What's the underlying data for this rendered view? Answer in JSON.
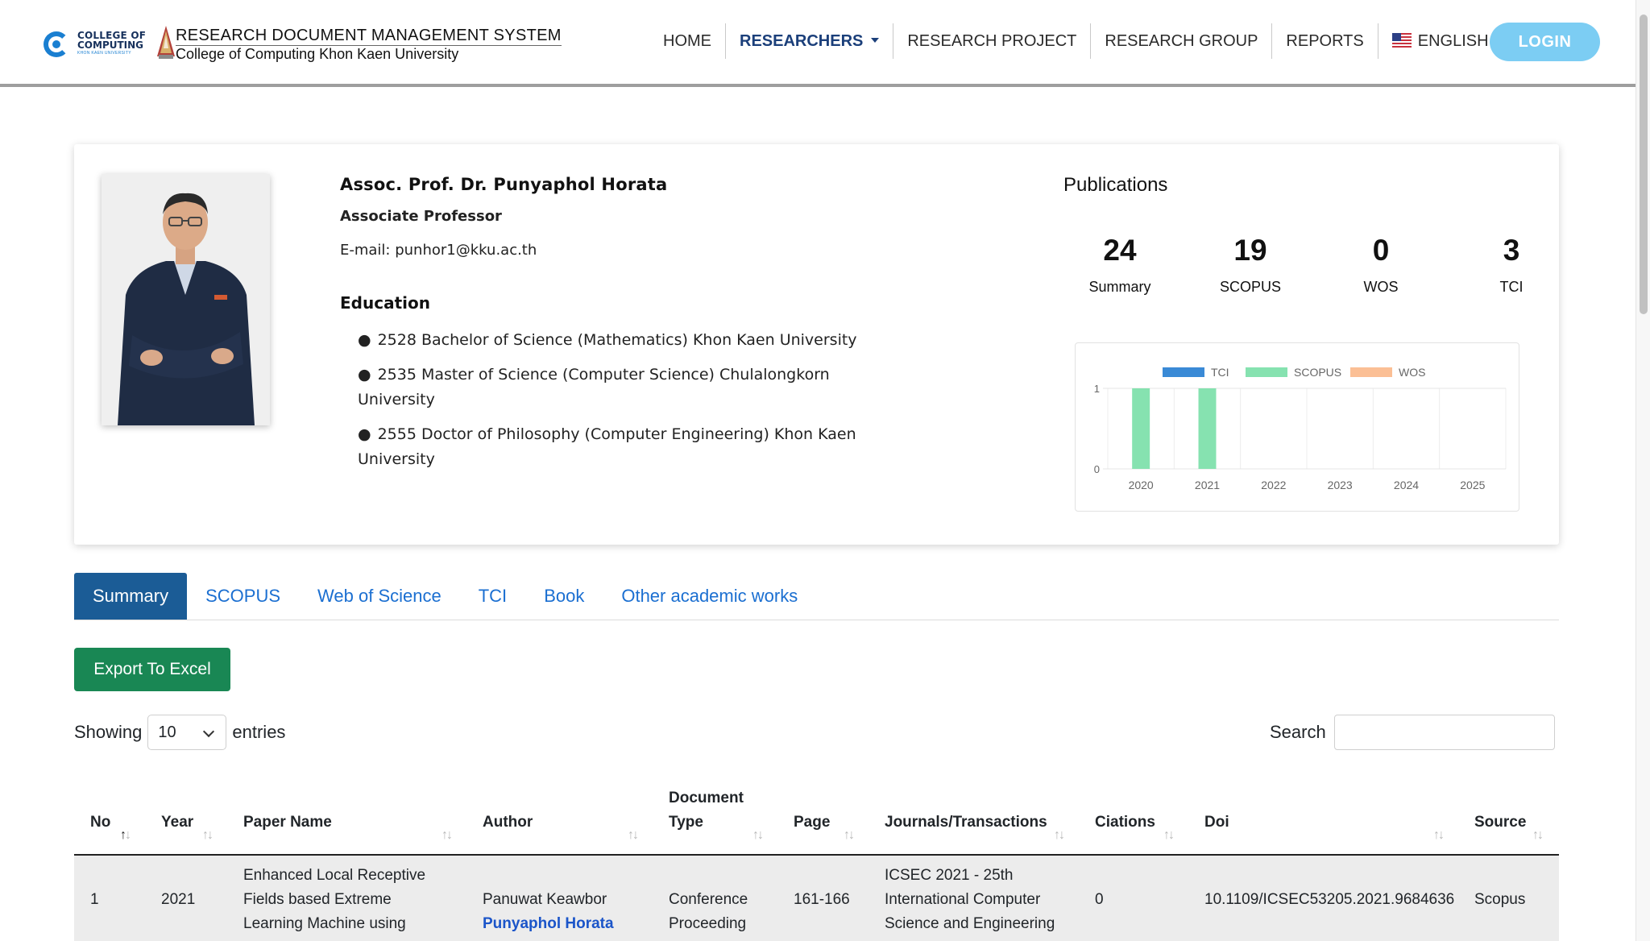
{
  "header": {
    "logo_line1": "COLLEGE OF",
    "logo_line2": "COMPUTING",
    "logo_line3": "KHON KAEN UNIVERSITY",
    "title": "RESEARCH DOCUMENT MANAGEMENT SYSTEM",
    "subtitle": "College of Computing Khon Kaen University"
  },
  "nav": {
    "home": "HOME",
    "researchers": "RESEARCHERS",
    "research_project": "RESEARCH PROJECT",
    "research_group": "RESEARCH GROUP",
    "reports": "REPORTS",
    "language": "ENGLISH",
    "login": "LOGIN"
  },
  "profile": {
    "name": "Assoc. Prof. Dr. Punyaphol Horata",
    "position": "Associate Professor",
    "email": "E-mail:  punhor1@kku.ac.th",
    "education_title": "Education",
    "education": [
      {
        "line1": "2528 Bachelor of Science (Mathematics) Khon Kaen University",
        "line2": ""
      },
      {
        "line1": "2535 Master of Science (Computer Science) Chulalongkorn",
        "line2": "University"
      },
      {
        "line1": "2555 Doctor of Philosophy (Computer Engineering) Khon Kaen",
        "line2": "University"
      }
    ]
  },
  "publications": {
    "heading": "Publications",
    "stats": [
      {
        "value": "24",
        "label": "Summary"
      },
      {
        "value": "19",
        "label": "SCOPUS"
      },
      {
        "value": "0",
        "label": "WOS"
      },
      {
        "value": "3",
        "label": "TCI"
      }
    ]
  },
  "chart_data": {
    "type": "bar",
    "categories": [
      "2020",
      "2021",
      "2022",
      "2023",
      "2024",
      "2025"
    ],
    "series": [
      {
        "name": "TCI",
        "values": [
          0,
          0,
          0,
          0,
          0,
          0
        ],
        "color": "#3a8ad6"
      },
      {
        "name": "SCOPUS",
        "values": [
          1,
          1,
          0,
          0,
          0,
          0
        ],
        "color": "#86e2b0"
      },
      {
        "name": "WOS",
        "values": [
          0,
          0,
          0,
          0,
          0,
          0
        ],
        "color": "#fbbf95"
      }
    ],
    "ylim": [
      0,
      1
    ],
    "yticks": [
      "0",
      "1"
    ],
    "legend": "top",
    "grid": true
  },
  "tabs": [
    "Summary",
    "SCOPUS",
    "Web of Science",
    "TCI",
    "Book",
    "Other academic works"
  ],
  "controls": {
    "export": "Export To Excel",
    "showing": "Showing",
    "entries_value": "10",
    "entries": "entries",
    "search": "Search"
  },
  "table": {
    "columns": [
      "No",
      "Year",
      "Paper Name",
      "Author",
      "Document",
      "Type",
      "Page",
      "Journals/Transactions",
      "Ciations",
      "Doi",
      "Source"
    ],
    "rows": [
      {
        "no": "1",
        "year": "2021",
        "paper_l1": "Enhanced Local Receptive",
        "paper_l2": "Fields based Extreme",
        "paper_l3": "Learning Machine using",
        "author_l1": "Panuwat Keawbor",
        "author_l2": "Punyaphol Horata",
        "doctype_l1": "Conference",
        "doctype_l2": "Proceeding",
        "page": "161-166",
        "journal_l1": "ICSEC 2021 - 25th",
        "journal_l2": "International Computer",
        "journal_l3": "Science and Engineering",
        "citations": "0",
        "doi": "10.1109/ICSEC53205.2021.9684636",
        "source": "Scopus"
      }
    ]
  }
}
